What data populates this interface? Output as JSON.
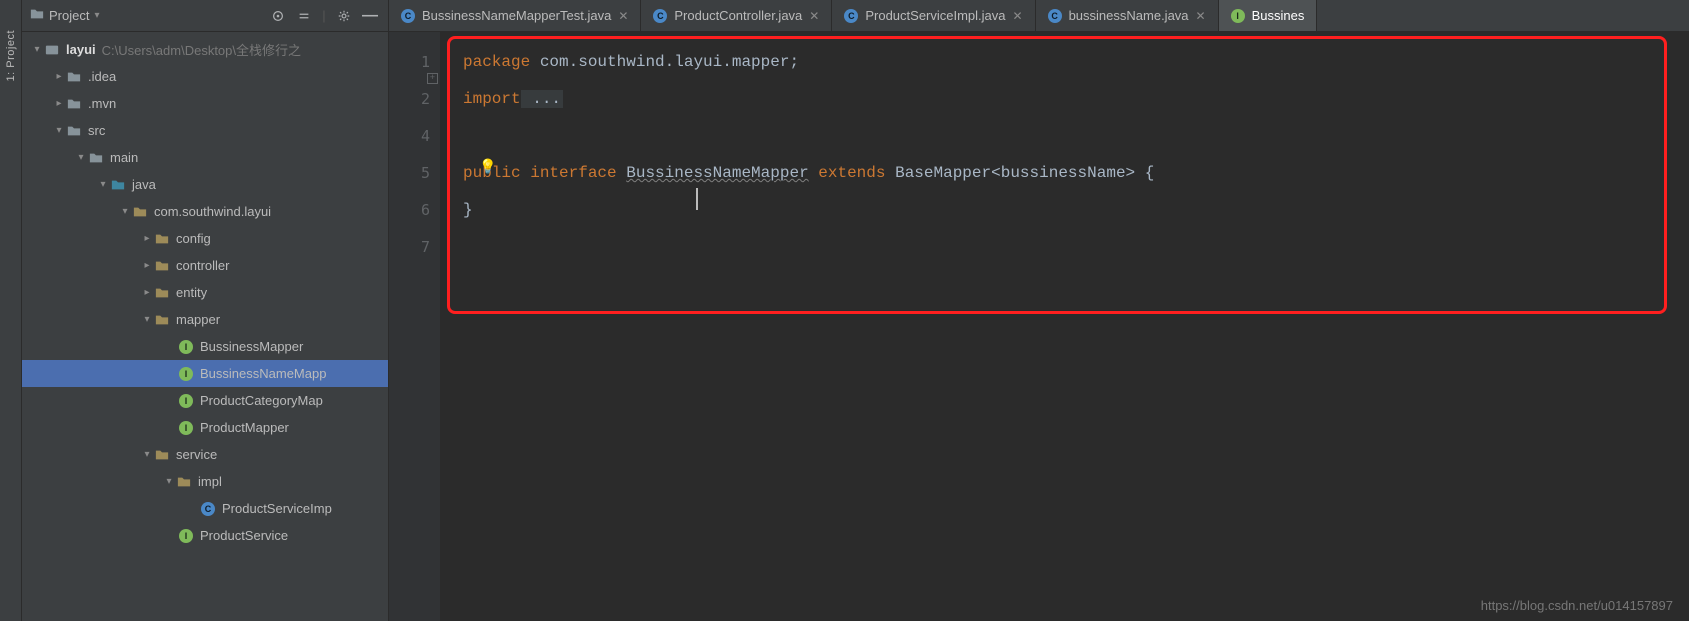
{
  "sidebar_tab": {
    "label": "1: Project"
  },
  "panel": {
    "title": "Project",
    "root_name": "layui",
    "root_path": "C:\\Users\\adm\\Desktop\\全栈修行之",
    "nodes": {
      "idea": ".idea",
      "mvn": ".mvn",
      "src": "src",
      "main": "main",
      "java": "java",
      "pkg": "com.southwind.layui",
      "config": "config",
      "controller": "controller",
      "entity": "entity",
      "mapper": "mapper",
      "m1": "BussinessMapper",
      "m2": "BussinessNameMapp",
      "m3": "ProductCategoryMap",
      "m4": "ProductMapper",
      "service": "service",
      "impl": "impl",
      "s1": "ProductServiceImp",
      "s2": "ProductService"
    }
  },
  "tabs": [
    {
      "label": "BussinessNameMapperTest.java",
      "kind": "c"
    },
    {
      "label": "ProductController.java",
      "kind": "c"
    },
    {
      "label": "ProductServiceImpl.java",
      "kind": "c"
    },
    {
      "label": "bussinessName.java",
      "kind": "c"
    },
    {
      "label": "Bussines",
      "kind": "i",
      "active": true
    }
  ],
  "code": {
    "line1_kw": "package",
    "line1_rest": " com.southwind.layui.mapper;",
    "line2_kw": "import",
    "line2_dots": " ...",
    "line5_public": "public",
    "line5_interface": " interface ",
    "line5_name": "BussinessNameMapper",
    "line5_extends": " extends ",
    "line5_base": "BaseMapper<",
    "line5_param": "bussinessName",
    "line5_end": "> {",
    "line6": "}"
  },
  "gutter": [
    "1",
    "2",
    "4",
    "5",
    "6",
    "7"
  ],
  "bulb": "💡",
  "watermark": "https://blog.csdn.net/u014157897"
}
